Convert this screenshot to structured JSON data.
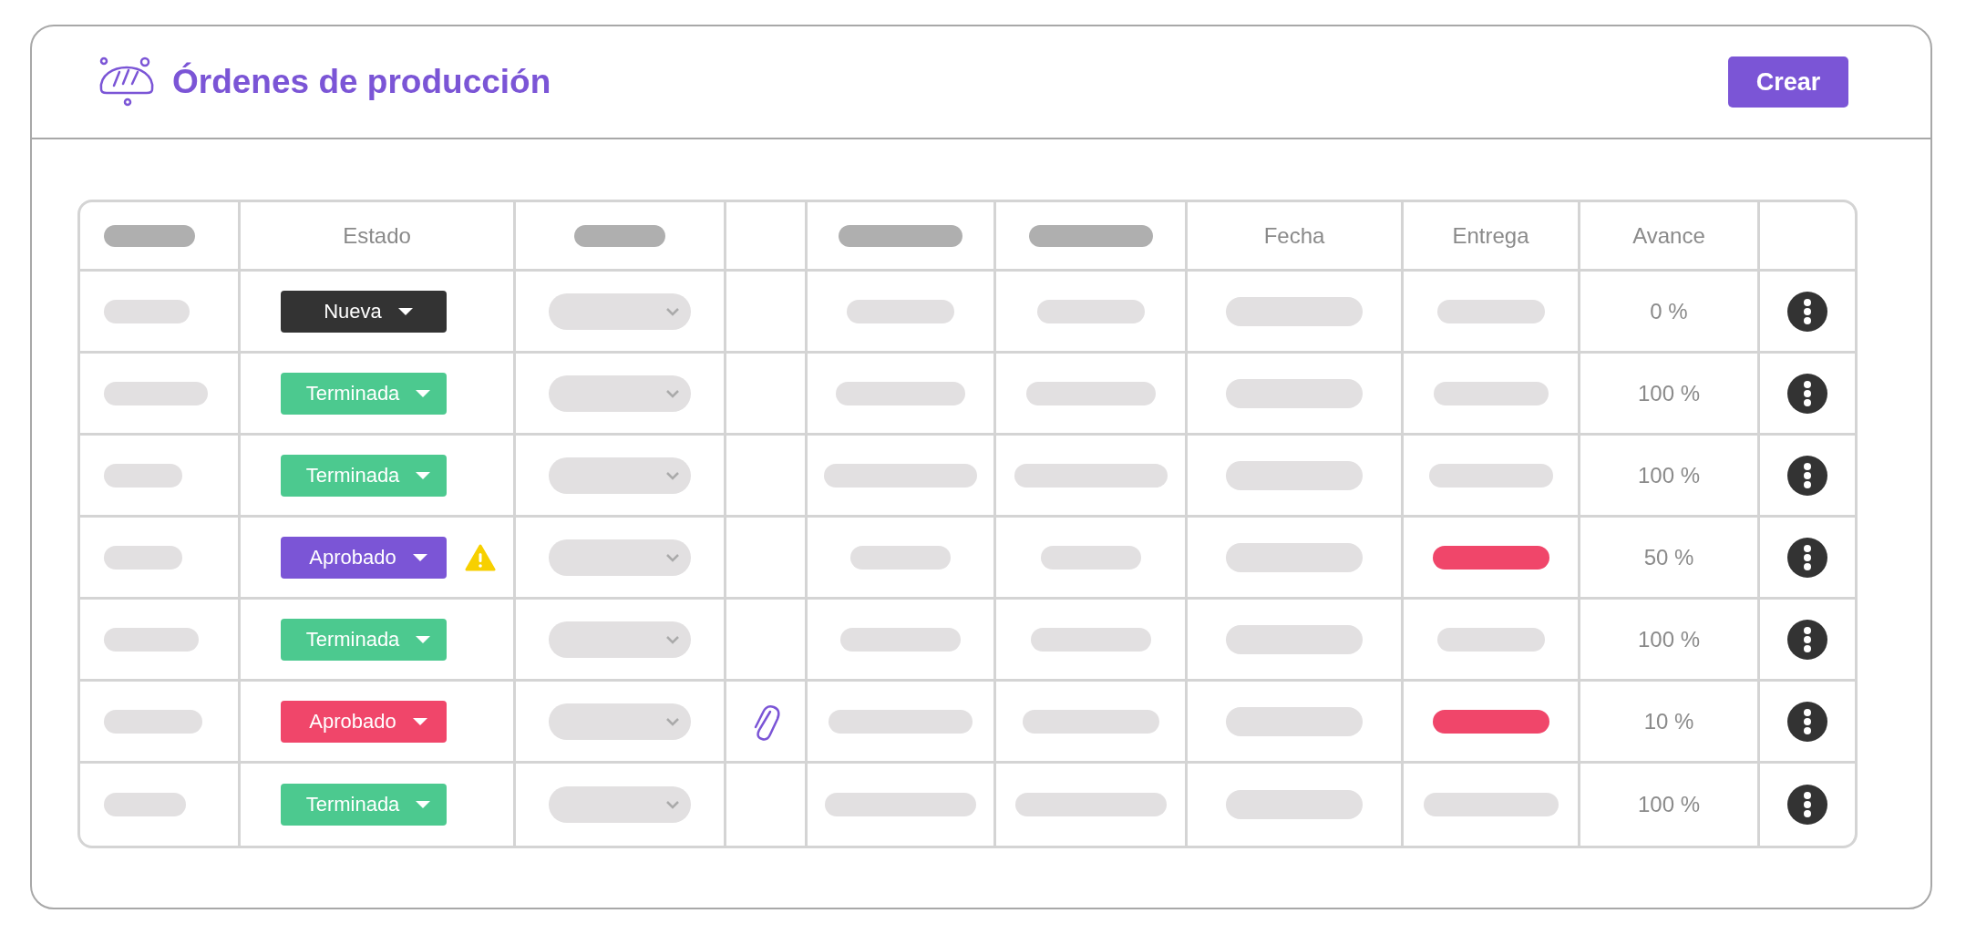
{
  "header": {
    "title": "Órdenes de producción",
    "create_button": "Crear"
  },
  "table": {
    "columns": [
      {
        "kind": "placeholder"
      },
      {
        "kind": "text",
        "label": "Estado"
      },
      {
        "kind": "placeholder"
      },
      {
        "kind": "empty"
      },
      {
        "kind": "placeholder"
      },
      {
        "kind": "placeholder"
      },
      {
        "kind": "text",
        "label": "Fecha"
      },
      {
        "kind": "text",
        "label": "Entrega"
      },
      {
        "kind": "text",
        "label": "Avance"
      },
      {
        "kind": "empty"
      }
    ],
    "rows": [
      {
        "status": "Nueva",
        "color": "#333333",
        "warning": false,
        "attachment": false,
        "late": false,
        "progress": "0 %"
      },
      {
        "status": "Terminada",
        "color": "#4cc98f",
        "warning": false,
        "attachment": false,
        "late": false,
        "progress": "100 %"
      },
      {
        "status": "Terminada",
        "color": "#4cc98f",
        "warning": false,
        "attachment": false,
        "late": false,
        "progress": "100 %"
      },
      {
        "status": "Aprobado",
        "color": "#7b55d6",
        "warning": true,
        "attachment": false,
        "late": true,
        "progress": "50 %"
      },
      {
        "status": "Terminada",
        "color": "#4cc98f",
        "warning": false,
        "attachment": false,
        "late": false,
        "progress": "100 %"
      },
      {
        "status": "Aprobado",
        "color": "#f0466a",
        "warning": false,
        "attachment": true,
        "late": true,
        "progress": "10 %"
      },
      {
        "status": "Terminada",
        "color": "#4cc98f",
        "warning": false,
        "attachment": false,
        "late": false,
        "progress": "100 %"
      }
    ]
  }
}
